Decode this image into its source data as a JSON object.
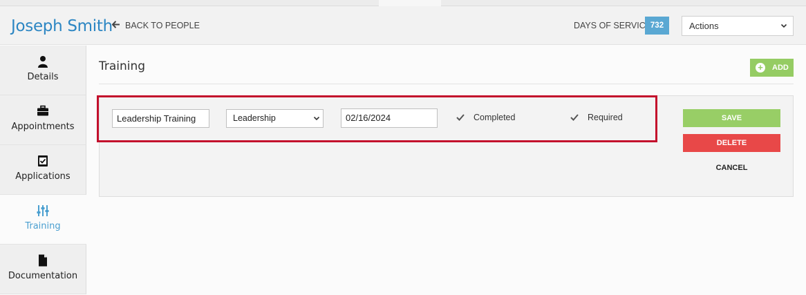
{
  "header": {
    "person_name": "Joseph Smith",
    "back_label": "BACK TO PEOPLE",
    "days_of_service_label": "DAYS OF SERVICE",
    "days_of_service_value": "732",
    "actions_label": "Actions"
  },
  "sidebar": {
    "items": [
      {
        "label": "Details",
        "icon": "person-icon"
      },
      {
        "label": "Appointments",
        "icon": "briefcase-icon"
      },
      {
        "label": "Applications",
        "icon": "checklist-icon"
      },
      {
        "label": "Training",
        "icon": "sliders-icon",
        "active": true
      },
      {
        "label": "Documentation",
        "icon": "document-icon"
      }
    ]
  },
  "main": {
    "title": "Training",
    "add_label": "ADD",
    "form": {
      "name_value": "Leadership Training",
      "category_value": "Leadership",
      "date_value": "02/16/2024",
      "completed_label": "Completed",
      "completed_checked": true,
      "required_label": "Required",
      "required_checked": true
    },
    "buttons": {
      "save": "SAVE",
      "delete": "DELETE",
      "cancel": "CANCEL"
    }
  },
  "colors": {
    "accent_blue": "#2c86c3",
    "badge_blue": "#5aa8d3",
    "save_green": "#98ce66",
    "delete_red": "#e84848",
    "highlight_red": "#c30f2c"
  }
}
